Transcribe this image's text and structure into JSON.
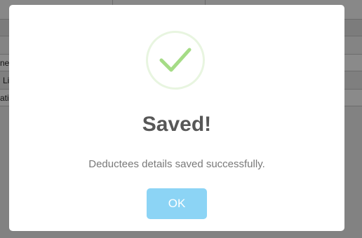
{
  "background": {
    "rows": [
      "ne",
      "Li",
      "atic"
    ]
  },
  "dialog": {
    "icon": "success-check-icon",
    "title": "Saved!",
    "message": "Deductees details saved successfully.",
    "ok_label": "OK",
    "colors": {
      "check": "#a5dc86",
      "ring": "#e8f5e0",
      "button": "#8cd4f5",
      "title": "#575757",
      "message": "#797979"
    }
  }
}
